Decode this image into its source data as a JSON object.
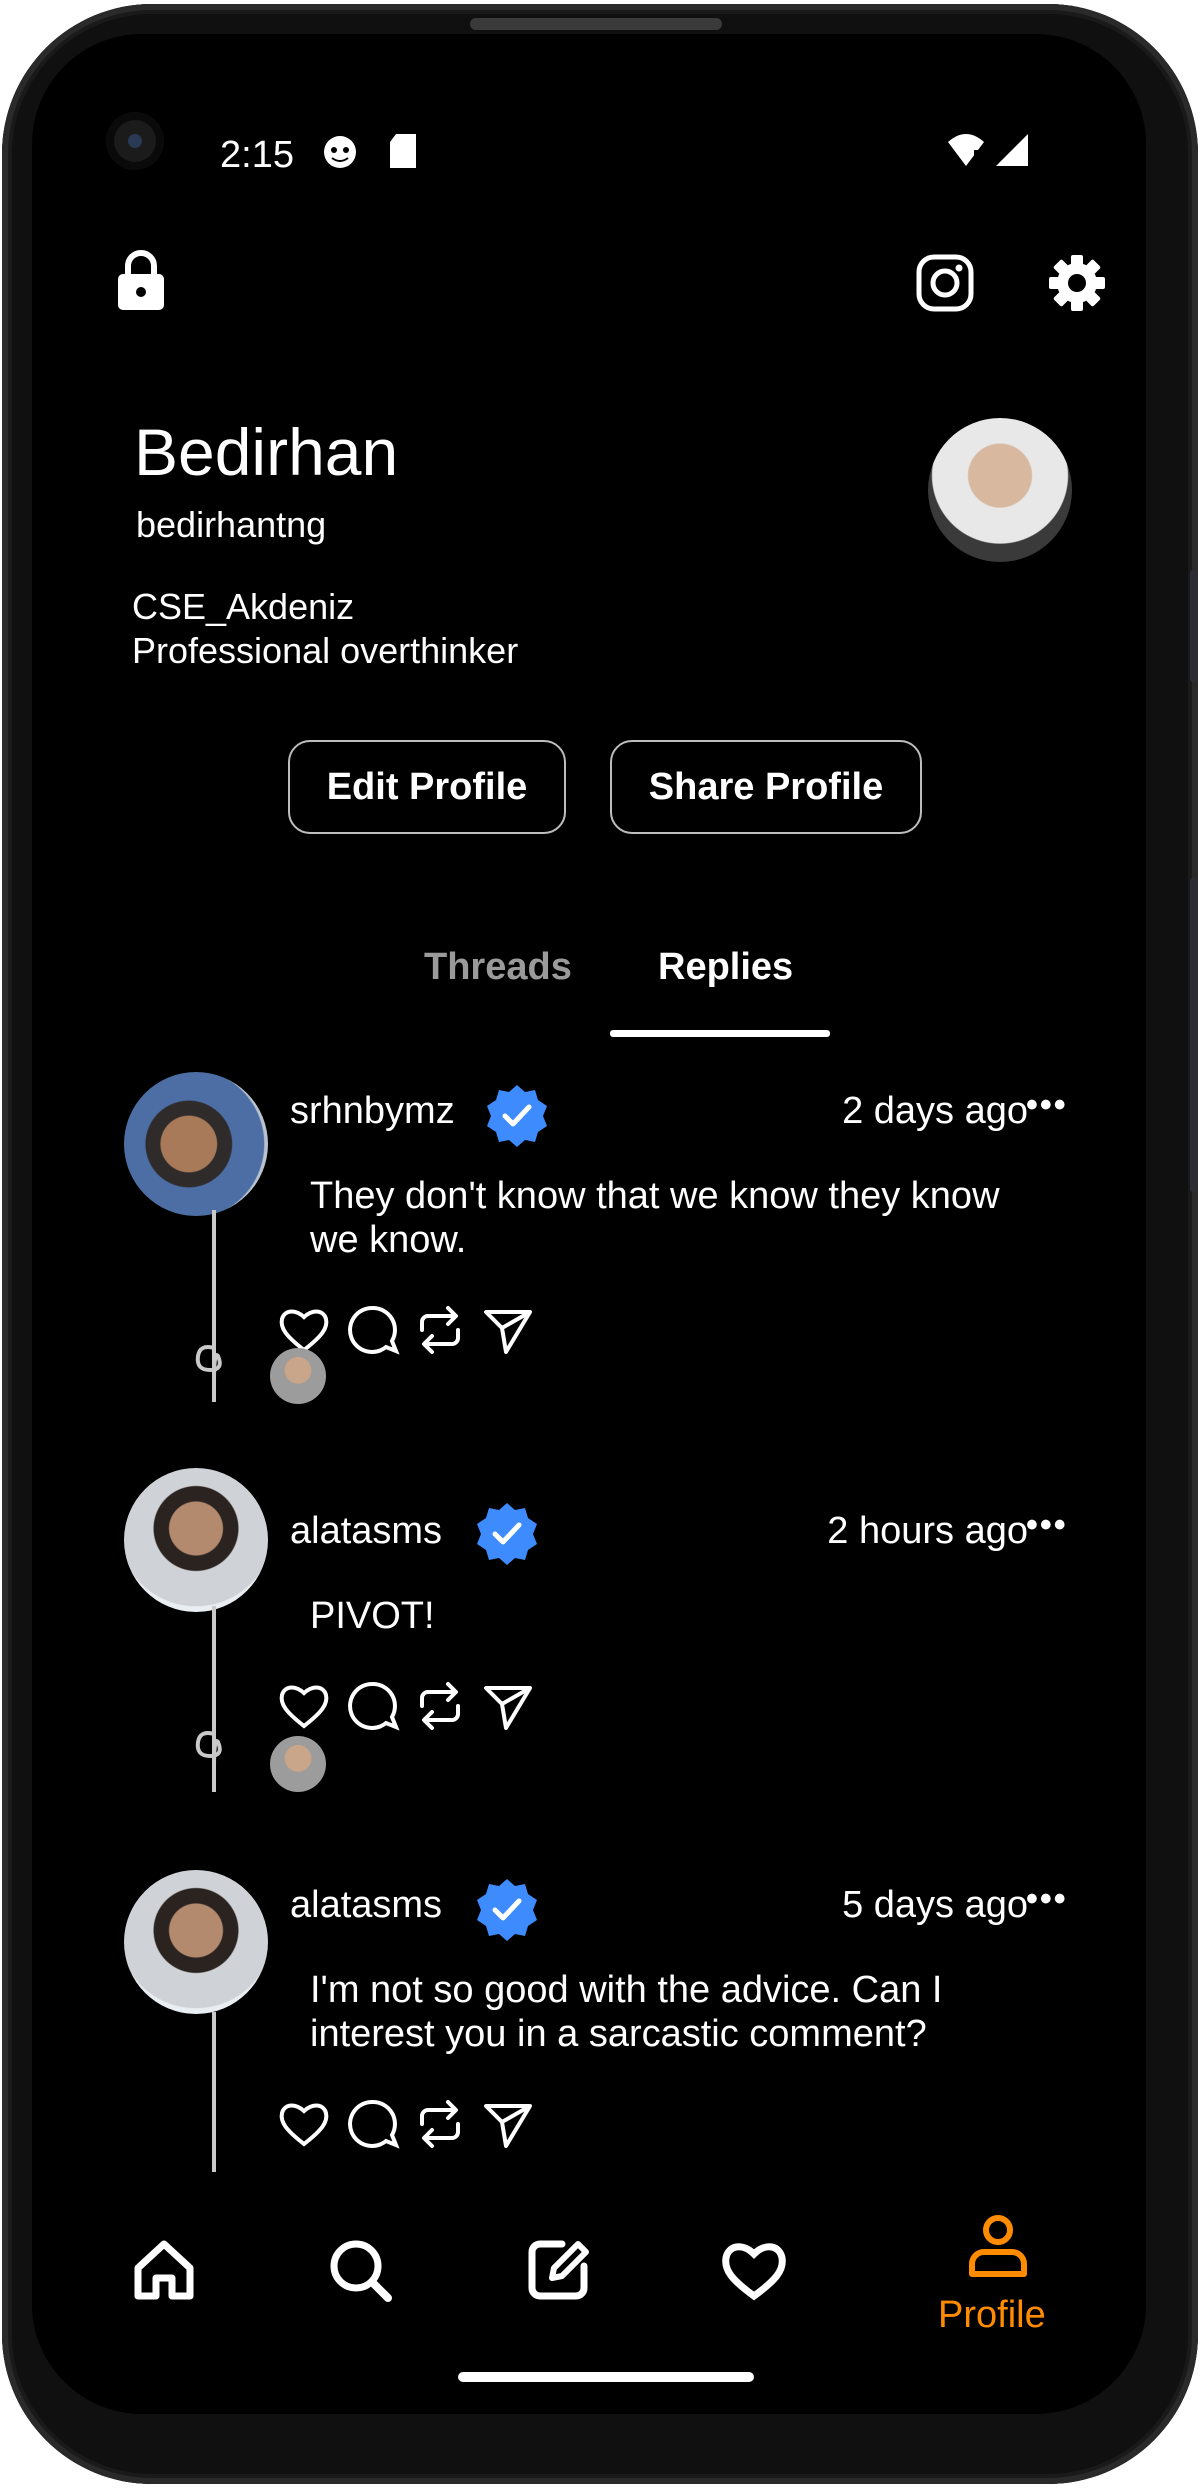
{
  "status_bar": {
    "time": "2:15"
  },
  "profile": {
    "name": "Bedirhan",
    "handle": "bedirhantng",
    "bio_line1": "CSE_Akdeniz",
    "bio_line2": "Professional overthinker",
    "edit_button": "Edit Profile",
    "share_button": "Share Profile"
  },
  "tabs": [
    {
      "label": "Threads",
      "active": false
    },
    {
      "label": "Replies",
      "active": true
    }
  ],
  "posts": [
    {
      "username": "srhnbymz",
      "verified": true,
      "time": "2 days ago",
      "text": "They don't know that we know they know we know."
    },
    {
      "username": "alatasms",
      "verified": true,
      "time": "2 hours ago",
      "text": "PIVOT!"
    },
    {
      "username": "alatasms",
      "verified": true,
      "time": "5 days ago",
      "text": "I'm not so good with the advice. Can I interest you in a sarcastic comment?"
    }
  ],
  "more_glyph": "•••",
  "bottom_nav": {
    "items": [
      "home-icon",
      "search-icon",
      "compose-icon",
      "heart-icon",
      "profile-icon"
    ],
    "active_label": "Profile",
    "accent_color": "#ff8c00"
  },
  "colors": {
    "background": "#000000",
    "verified": "#3d8bfd",
    "accent": "#ff8c00"
  }
}
